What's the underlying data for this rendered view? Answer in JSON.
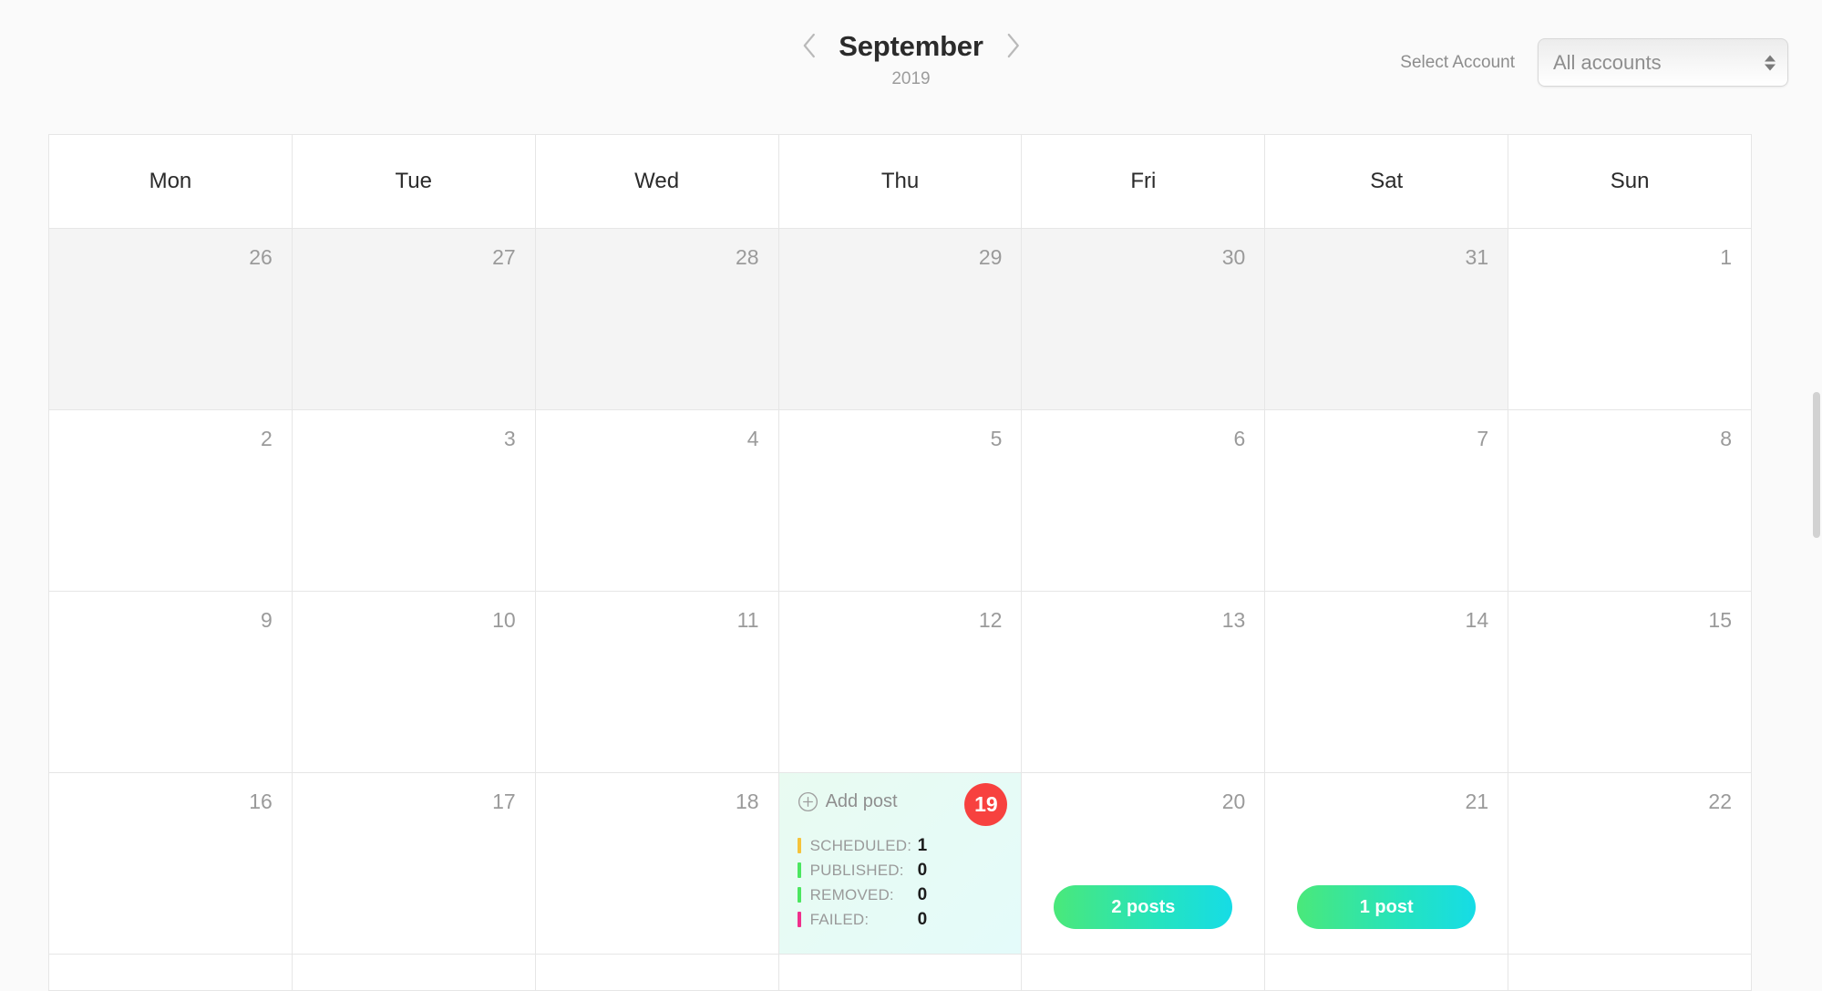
{
  "header": {
    "prev_icon": "chevron-left-icon",
    "next_icon": "chevron-right-icon",
    "month": "September",
    "year": "2019",
    "account_label": "Select Account",
    "account_value": "All accounts"
  },
  "weekdays": [
    "Mon",
    "Tue",
    "Wed",
    "Thu",
    "Fri",
    "Sat",
    "Sun"
  ],
  "colors": {
    "badge_red": "#f7413f",
    "scheduled": "#f5c33b",
    "published": "#4ce660",
    "removed": "#4ce660",
    "failed": "#f0308c",
    "pill_gradient_start": "#4ae87a",
    "pill_gradient_end": "#16dce6"
  },
  "cell_detail": {
    "add_post_label": "Add post",
    "add_post_icon": "plus-circle-icon",
    "stats": [
      {
        "label": "SCHEDULED:",
        "value": "1",
        "color": "#f5c33b"
      },
      {
        "label": "PUBLISHED:",
        "value": "0",
        "color": "#4ce660"
      },
      {
        "label": "REMOVED:",
        "value": "0",
        "color": "#4ce660"
      },
      {
        "label": "FAILED:",
        "value": "0",
        "color": "#f0308c"
      }
    ]
  },
  "weeks": [
    [
      {
        "day": "26",
        "out": true
      },
      {
        "day": "27",
        "out": true
      },
      {
        "day": "28",
        "out": true
      },
      {
        "day": "29",
        "out": true
      },
      {
        "day": "30",
        "out": true
      },
      {
        "day": "31",
        "out": true
      },
      {
        "day": "1",
        "out": false
      }
    ],
    [
      {
        "day": "2",
        "out": false
      },
      {
        "day": "3",
        "out": false
      },
      {
        "day": "4",
        "out": false
      },
      {
        "day": "5",
        "out": false
      },
      {
        "day": "6",
        "out": false
      },
      {
        "day": "7",
        "out": false
      },
      {
        "day": "8",
        "out": false
      }
    ],
    [
      {
        "day": "9",
        "out": false
      },
      {
        "day": "10",
        "out": false
      },
      {
        "day": "11",
        "out": false
      },
      {
        "day": "12",
        "out": false
      },
      {
        "day": "13",
        "out": false
      },
      {
        "day": "14",
        "out": false
      },
      {
        "day": "15",
        "out": false
      }
    ],
    [
      {
        "day": "16",
        "out": false
      },
      {
        "day": "17",
        "out": false
      },
      {
        "day": "18",
        "out": false
      },
      {
        "day": "19",
        "out": false,
        "today": true,
        "detail": true
      },
      {
        "day": "20",
        "out": false,
        "pill": "2 posts"
      },
      {
        "day": "21",
        "out": false,
        "pill": "1 post"
      },
      {
        "day": "22",
        "out": false
      }
    ]
  ]
}
